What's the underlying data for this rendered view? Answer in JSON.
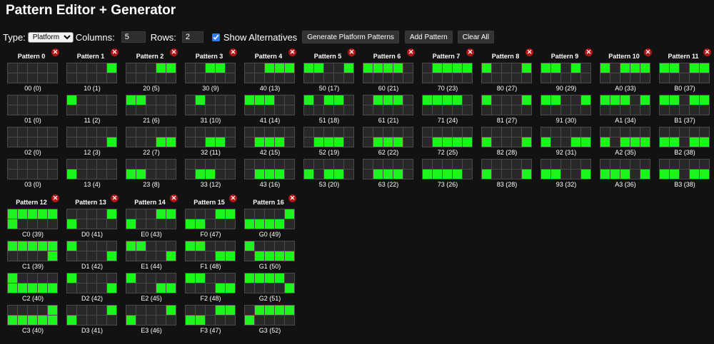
{
  "page": {
    "title": "Pattern Editor + Generator"
  },
  "toolbar": {
    "type_label": "Type:",
    "type_selected": "Platform",
    "columns_label": "Columns:",
    "columns_value": "5",
    "rows_label": "Rows:",
    "rows_value": "2",
    "show_alternatives_label": "Show Alternatives",
    "show_alternatives_checked": true,
    "generate_button": "Generate Platform Patterns",
    "add_button": "Add Pattern",
    "clear_button": "Clear All"
  },
  "colors": {
    "active_cell": "#1df51d",
    "inactive_cell": "#282828",
    "delete_button": "#b11616"
  },
  "patterns": [
    {
      "title": "Pattern 0",
      "variants": [
        {
          "caption": "00 (0)",
          "cells": "0000000000"
        },
        {
          "caption": "01 (0)",
          "cells": "0000000000"
        },
        {
          "caption": "02 (0)",
          "cells": "0000000000"
        },
        {
          "caption": "03 (0)",
          "cells": "0000000000"
        }
      ]
    },
    {
      "title": "Pattern 1",
      "variants": [
        {
          "caption": "10 (1)",
          "cells": "0000100000"
        },
        {
          "caption": "11 (2)",
          "cells": "1000000000"
        },
        {
          "caption": "12 (3)",
          "cells": "0000000001"
        },
        {
          "caption": "13 (4)",
          "cells": "0000010000"
        }
      ]
    },
    {
      "title": "Pattern 2",
      "variants": [
        {
          "caption": "20 (5)",
          "cells": "0001100000"
        },
        {
          "caption": "21 (6)",
          "cells": "1100000000"
        },
        {
          "caption": "22 (7)",
          "cells": "0000000011"
        },
        {
          "caption": "23 (8)",
          "cells": "0000011000"
        }
      ]
    },
    {
      "title": "Pattern 3",
      "variants": [
        {
          "caption": "30 (9)",
          "cells": "0011000000"
        },
        {
          "caption": "31 (10)",
          "cells": "0100000000"
        },
        {
          "caption": "32 (11)",
          "cells": "0000000110"
        },
        {
          "caption": "33 (12)",
          "cells": "0000001100"
        }
      ]
    },
    {
      "title": "Pattern 4",
      "variants": [
        {
          "caption": "40 (13)",
          "cells": "0011100000"
        },
        {
          "caption": "41 (14)",
          "cells": "1110000000"
        },
        {
          "caption": "42 (15)",
          "cells": "0000001110"
        },
        {
          "caption": "43 (16)",
          "cells": "0000001110"
        }
      ]
    },
    {
      "title": "Pattern 5",
      "variants": [
        {
          "caption": "50 (17)",
          "cells": "1100100000"
        },
        {
          "caption": "51 (18)",
          "cells": "1011000000"
        },
        {
          "caption": "52 (19)",
          "cells": "0000001110"
        },
        {
          "caption": "53 (20)",
          "cells": "0000010110"
        }
      ]
    },
    {
      "title": "Pattern 6",
      "variants": [
        {
          "caption": "60 (21)",
          "cells": "1111000000"
        },
        {
          "caption": "61 (21)",
          "cells": "0111000000"
        },
        {
          "caption": "62 (22)",
          "cells": "0000001110"
        },
        {
          "caption": "63 (22)",
          "cells": "0000001110"
        }
      ]
    },
    {
      "title": "Pattern 7",
      "variants": [
        {
          "caption": "70 (23)",
          "cells": "0111100000"
        },
        {
          "caption": "71 (24)",
          "cells": "1111000000"
        },
        {
          "caption": "72 (25)",
          "cells": "0000001111"
        },
        {
          "caption": "73 (26)",
          "cells": "0000011110"
        }
      ]
    },
    {
      "title": "Pattern 8",
      "variants": [
        {
          "caption": "80 (27)",
          "cells": "1000100000"
        },
        {
          "caption": "81 (27)",
          "cells": "1000100000"
        },
        {
          "caption": "82 (28)",
          "cells": "0000010001"
        },
        {
          "caption": "83 (28)",
          "cells": "0000010001"
        }
      ]
    },
    {
      "title": "Pattern 9",
      "variants": [
        {
          "caption": "90 (29)",
          "cells": "1101000000"
        },
        {
          "caption": "91 (30)",
          "cells": "1100100000"
        },
        {
          "caption": "92 (31)",
          "cells": "0000010011"
        },
        {
          "caption": "93 (32)",
          "cells": "0000011001"
        }
      ]
    },
    {
      "title": "Pattern 10",
      "variants": [
        {
          "caption": "A0 (33)",
          "cells": "1011100000"
        },
        {
          "caption": "A1 (34)",
          "cells": "1110100000"
        },
        {
          "caption": "A2 (35)",
          "cells": "0000010111"
        },
        {
          "caption": "A3 (36)",
          "cells": "0000011101"
        }
      ]
    },
    {
      "title": "Pattern 11",
      "variants": [
        {
          "caption": "B0 (37)",
          "cells": "1101100000"
        },
        {
          "caption": "B1 (37)",
          "cells": "1101100000"
        },
        {
          "caption": "B2 (38)",
          "cells": "0000011011"
        },
        {
          "caption": "B3 (38)",
          "cells": "0000011011"
        }
      ]
    },
    {
      "title": "Pattern 12",
      "variants": [
        {
          "caption": "C0 (39)",
          "cells": "1111110000"
        },
        {
          "caption": "C1 (39)",
          "cells": "1111100001"
        },
        {
          "caption": "C2 (40)",
          "cells": "1000011111"
        },
        {
          "caption": "C3 (40)",
          "cells": "0000111111"
        }
      ]
    },
    {
      "title": "Pattern 13",
      "variants": [
        {
          "caption": "D0 (41)",
          "cells": "0000110000"
        },
        {
          "caption": "D1 (42)",
          "cells": "1000000001"
        },
        {
          "caption": "D2 (42)",
          "cells": "1000000001"
        },
        {
          "caption": "D3 (41)",
          "cells": "0000110000"
        }
      ]
    },
    {
      "title": "Pattern 14",
      "variants": [
        {
          "caption": "E0 (43)",
          "cells": "0001110000"
        },
        {
          "caption": "E1 (44)",
          "cells": "1100000001"
        },
        {
          "caption": "E2 (45)",
          "cells": "1000000011"
        },
        {
          "caption": "E3 (46)",
          "cells": "0000110000"
        }
      ]
    },
    {
      "title": "Pattern 15",
      "variants": [
        {
          "caption": "F0 (47)",
          "cells": "0001111000"
        },
        {
          "caption": "F1 (48)",
          "cells": "1100000011"
        },
        {
          "caption": "F2 (48)",
          "cells": "1100000011"
        },
        {
          "caption": "F3 (47)",
          "cells": "0001111000"
        }
      ]
    },
    {
      "title": "Pattern 16",
      "variants": [
        {
          "caption": "G0 (49)",
          "cells": "0000111110"
        },
        {
          "caption": "G1 (50)",
          "cells": "1000001111"
        },
        {
          "caption": "G2 (51)",
          "cells": "1111000001"
        },
        {
          "caption": "G3 (52)",
          "cells": "0111110000"
        }
      ]
    }
  ]
}
